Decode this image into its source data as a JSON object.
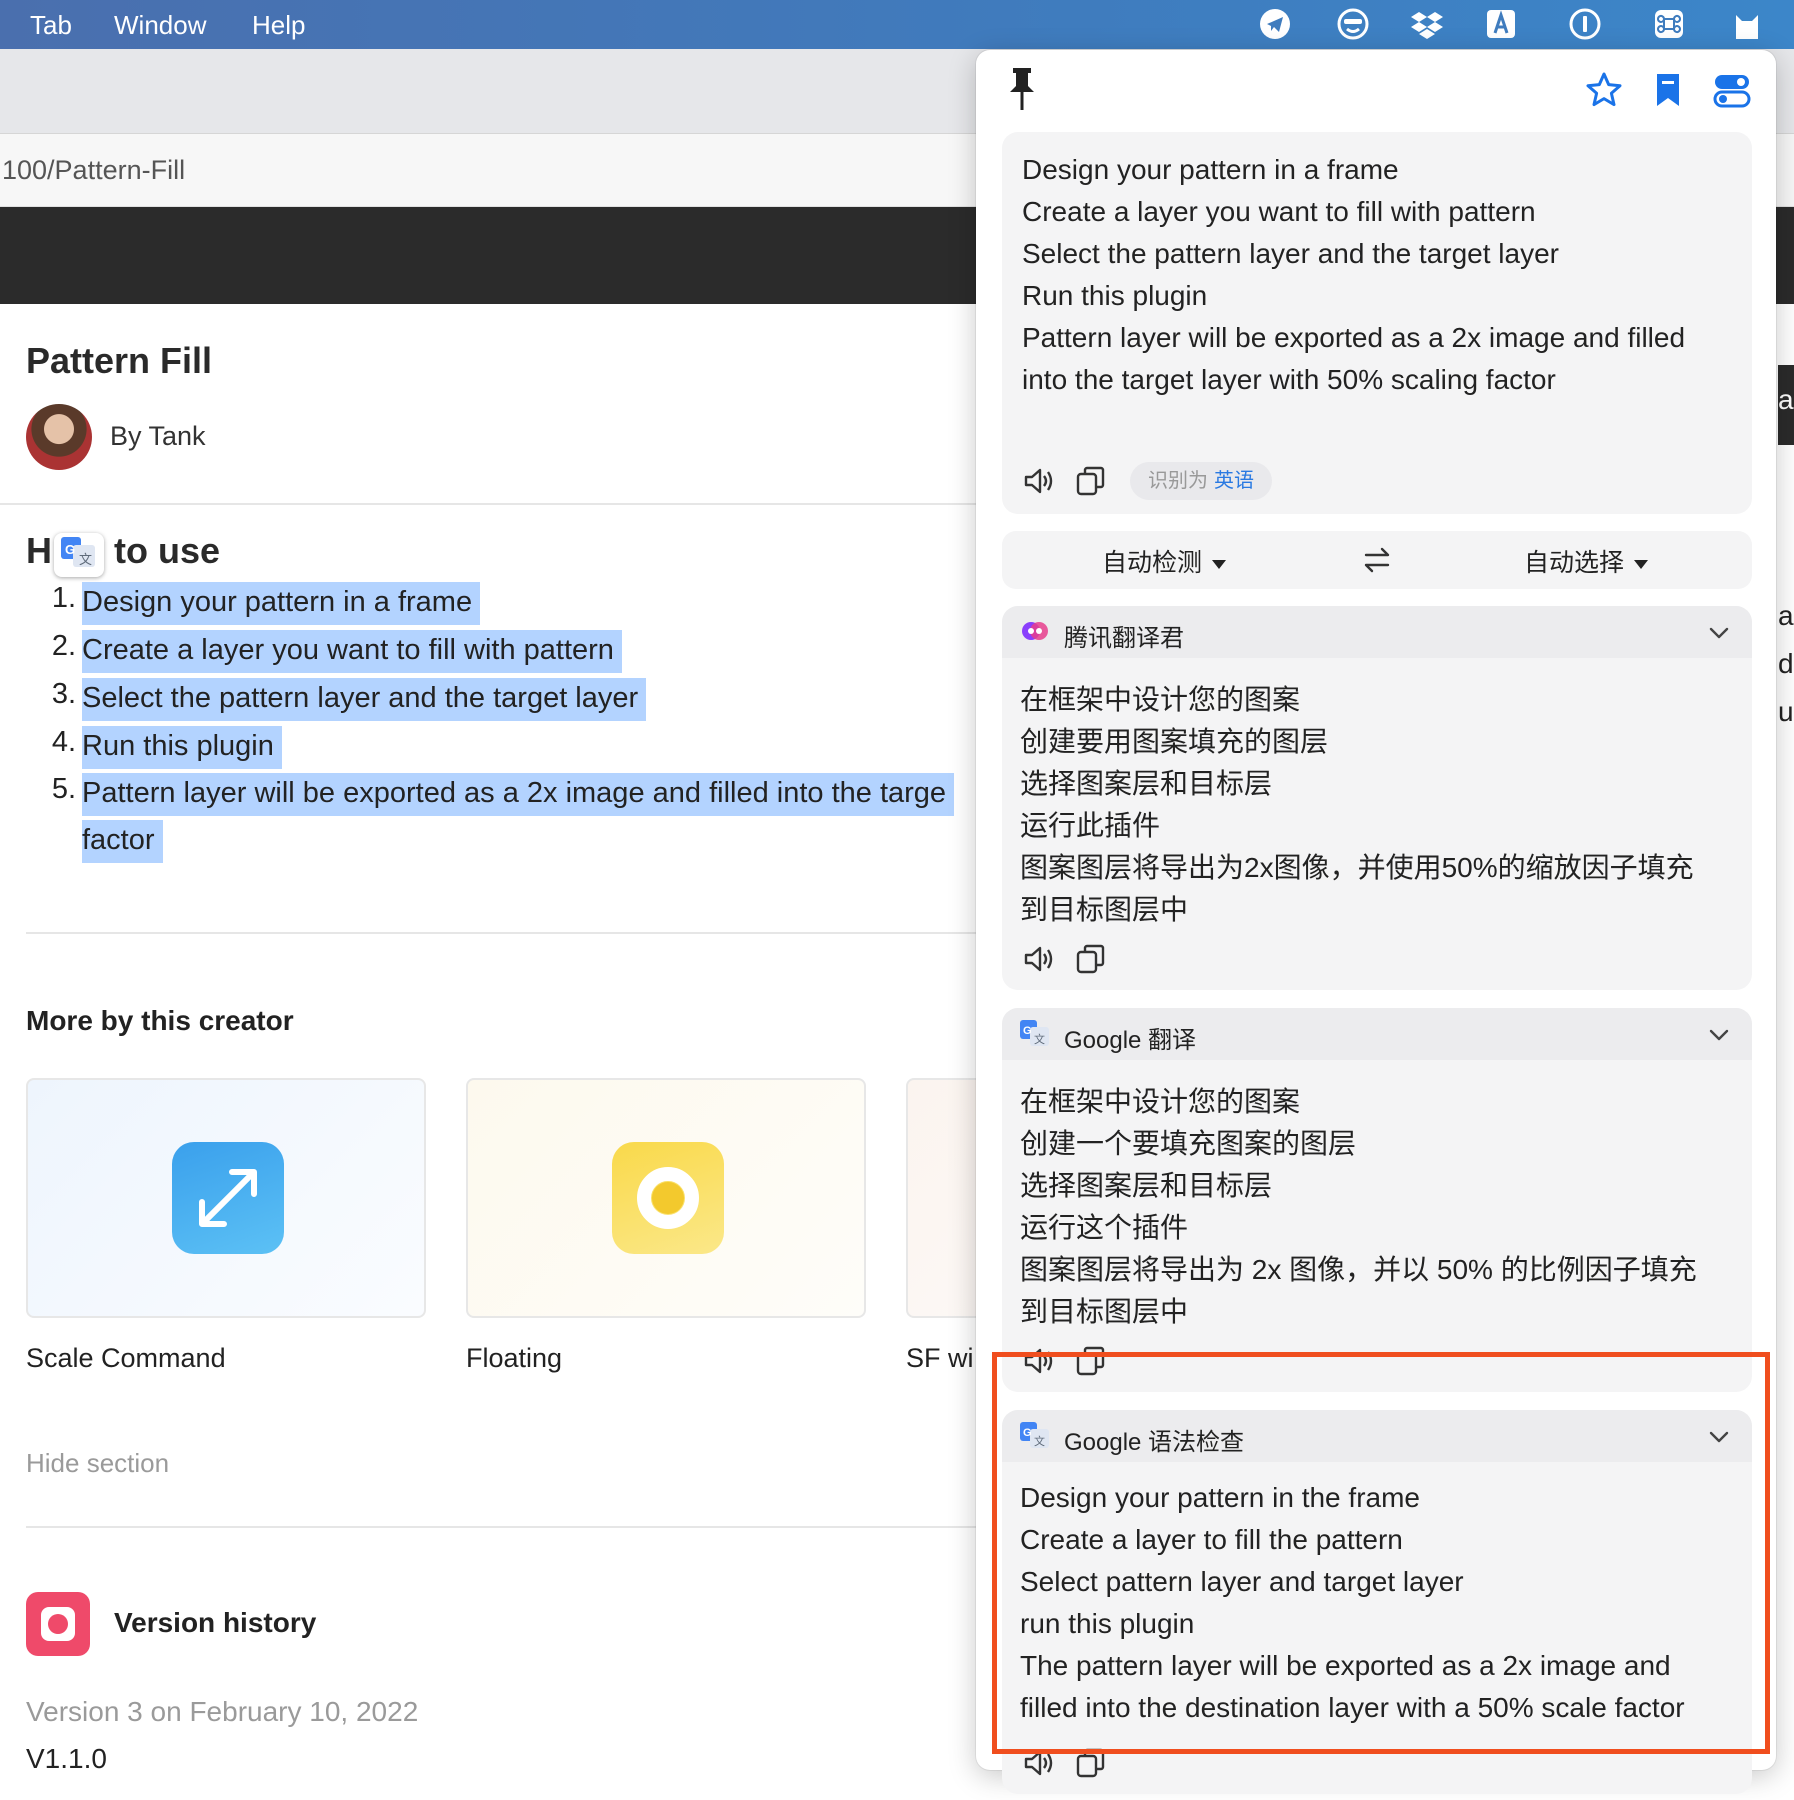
{
  "menubar": {
    "items": [
      "Tab",
      "Window",
      "Help"
    ],
    "tray_icons": [
      "telegram-icon",
      "smiley-icon",
      "dropbox-icon",
      "keyboard-a-icon",
      "onepassword-icon",
      "command-icon",
      "cat-icon"
    ]
  },
  "browser": {
    "url": "100/Pattern-Fill"
  },
  "page": {
    "title": "Pattern Fill",
    "author": "By Tank",
    "how_to_use": {
      "heading_h": "H",
      "heading_rest": "to use"
    },
    "steps": [
      {
        "num": "1.",
        "text": "Design your pattern in a frame"
      },
      {
        "num": "2.",
        "text": "Create a layer you want to fill with pattern"
      },
      {
        "num": "3.",
        "text": "Select the pattern layer and the target layer"
      },
      {
        "num": "4.",
        "text": "Run this plugin"
      },
      {
        "num": "5.",
        "text": "Pattern layer will be exported as a 2x image and filled into the targe"
      },
      {
        "num": "",
        "text": "factor"
      }
    ],
    "more_heading": "More by this creator",
    "cards": [
      {
        "label": "Scale Command"
      },
      {
        "label": "Floating"
      },
      {
        "label": "SF wi"
      }
    ],
    "hide_section": "Hide section",
    "version": {
      "heading": "Version history",
      "date": "Version 3 on February 10, 2022",
      "number": "V1.1.0"
    },
    "right_clipped": [
      "al",
      "ag",
      "d",
      "u"
    ]
  },
  "popup": {
    "source_lines": [
      "Design your pattern in a frame",
      "Create a layer you want to fill with pattern",
      "Select the pattern layer and the target layer",
      "Run this plugin",
      "Pattern layer will be exported as a 2x image and filled",
      "into the target layer with 50% scaling factor"
    ],
    "detected_prefix": "识别为",
    "detected_lang": "英语",
    "source_lang": "自动检测",
    "target_lang": "自动选择",
    "results": [
      {
        "service": "腾讯翻译君",
        "icon": "tencent-translate-icon",
        "lines": [
          "在框架中设计您的图案",
          "创建要用图案填充的图层",
          "选择图案层和目标层",
          "运行此插件",
          "图案图层将导出为2x图像，并使用50%的缩放因子填充",
          "到目标图层中"
        ]
      },
      {
        "service": "Google 翻译",
        "icon": "google-translate-icon",
        "lines": [
          "在框架中设计您的图案",
          "创建一个要填充图案的图层",
          "选择图案层和目标层",
          "运行这个插件",
          "图案图层将导出为 2x 图像，并以 50% 的比例因子填充",
          "到目标图层中"
        ]
      },
      {
        "service": "Google 语法检查",
        "icon": "google-translate-icon",
        "lines": [
          "Design your pattern in the frame",
          "Create a layer to fill the pattern",
          "Select pattern layer and target layer",
          "run this plugin",
          "The pattern layer will be exported as a 2x image and",
          "filled into the destination layer with a 50% scale factor"
        ]
      }
    ]
  },
  "colors": {
    "selection": "#b3d3ff",
    "accent": "#1a73e8",
    "highlight_border": "#f04e1e",
    "menubar": "#3f7cbe"
  }
}
